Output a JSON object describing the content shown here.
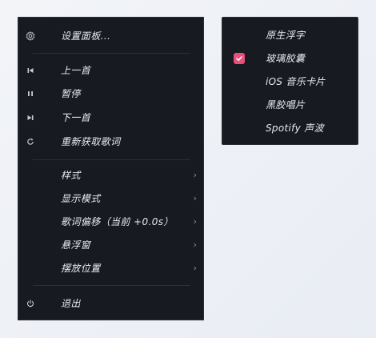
{
  "colors": {
    "menu_bg": "#171a21",
    "accent": "#e8507a",
    "text": "#e8eaf0"
  },
  "main_menu": {
    "settings": {
      "label": "设置面板...",
      "icon": "gear-icon"
    },
    "prev": {
      "label": "上一首",
      "icon": "skip-previous-icon"
    },
    "pause": {
      "label": "暂停",
      "icon": "pause-icon"
    },
    "next": {
      "label": "下一首",
      "icon": "skip-next-icon"
    },
    "refetch": {
      "label": "重新获取歌词",
      "icon": "refresh-icon"
    },
    "style": {
      "label": "样式",
      "chevron": "›"
    },
    "display_mode": {
      "label": "显示模式",
      "chevron": "›"
    },
    "lyric_offset": {
      "label": "歌词偏移（当前 +0.0s）",
      "chevron": "›"
    },
    "floating_window": {
      "label": "悬浮窗",
      "chevron": "›"
    },
    "position": {
      "label": "摆放位置",
      "chevron": "›"
    },
    "quit": {
      "label": "退出",
      "icon": "power-icon"
    }
  },
  "style_submenu": {
    "items": [
      {
        "label": "原生浮字",
        "checked": false
      },
      {
        "label": "玻璃胶囊",
        "checked": true
      },
      {
        "label": "iOS 音乐卡片",
        "checked": false
      },
      {
        "label": "黑胶唱片",
        "checked": false
      },
      {
        "label": "Spotify 声波",
        "checked": false
      }
    ]
  }
}
